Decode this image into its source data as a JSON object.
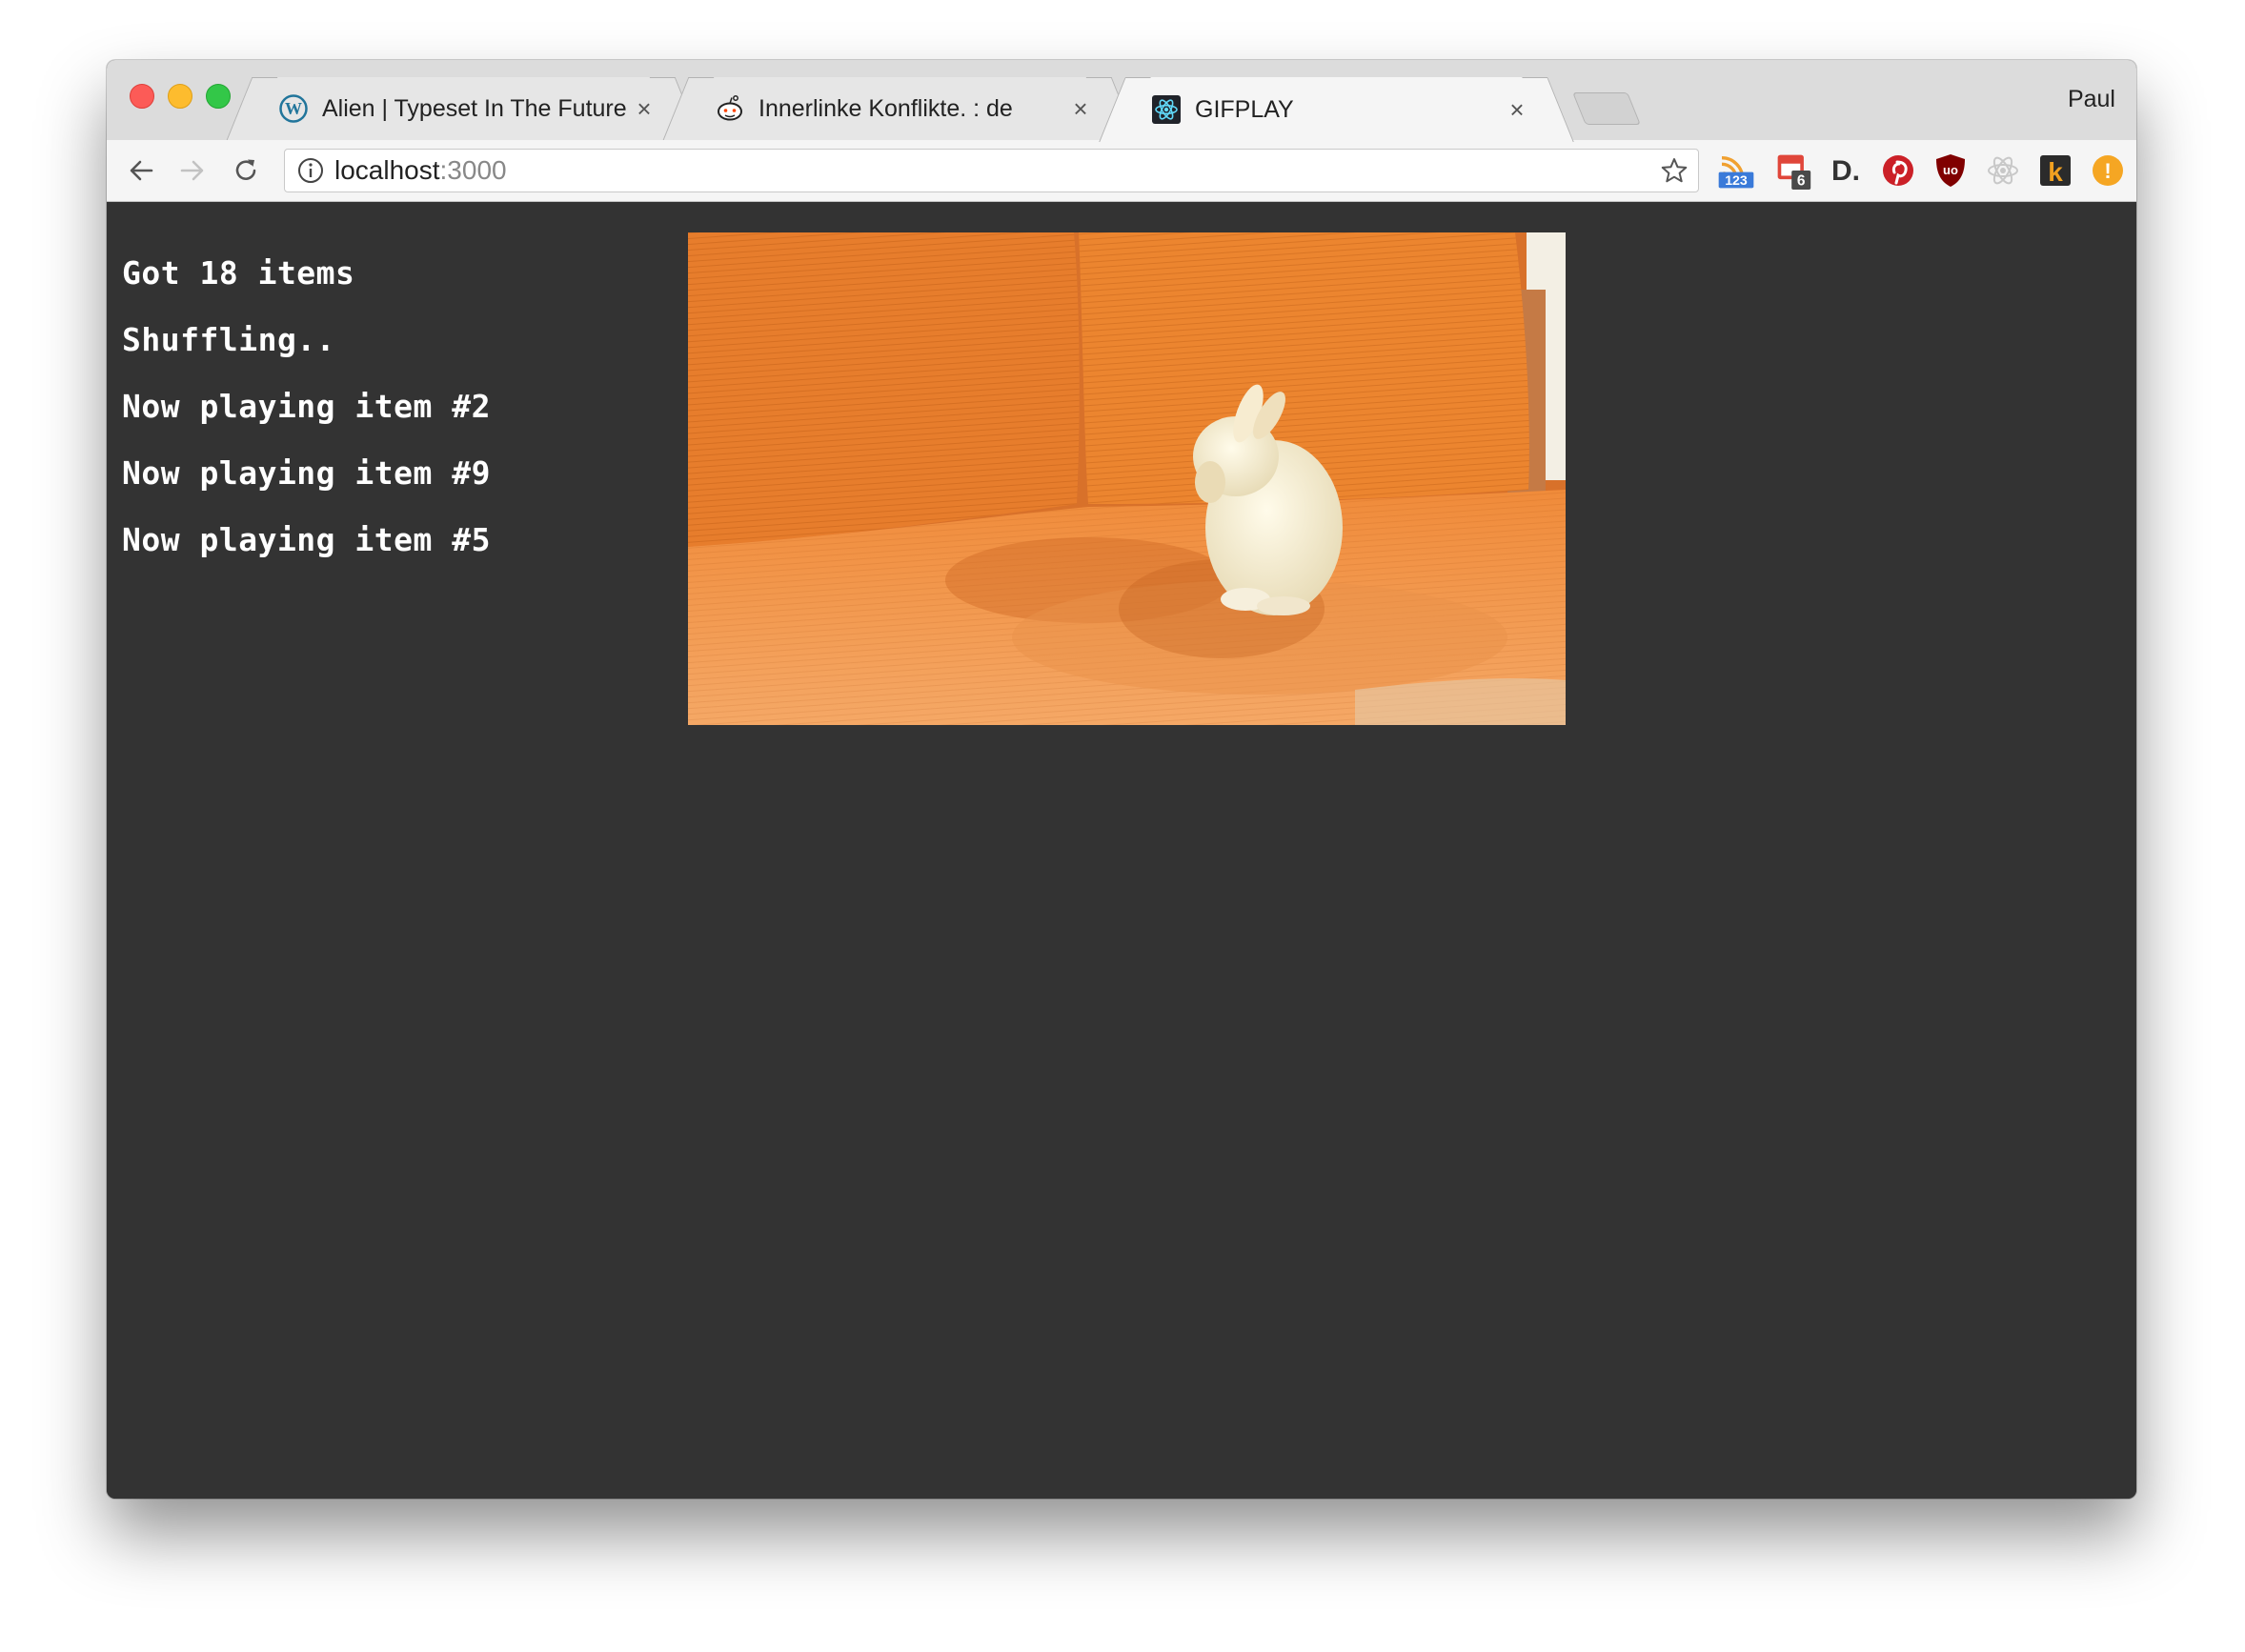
{
  "browser": {
    "tabs": [
      {
        "title": "Alien | Typeset In The Future",
        "favicon": "wordpress-icon",
        "active": false
      },
      {
        "title": "Innerlinke Konflikte. : de",
        "favicon": "reddit-icon",
        "active": false
      },
      {
        "title": "GIFPLAY",
        "favicon": "react-icon",
        "active": true
      }
    ],
    "close_glyph": "×",
    "profile_name": "Paul",
    "address": {
      "host": "localhost",
      "port": ":3000"
    },
    "extensions": [
      {
        "name": "rss-feed-icon",
        "badge": "123"
      },
      {
        "name": "calendar-icon",
        "badge": "6"
      },
      {
        "name": "d-icon",
        "label": "D."
      },
      {
        "name": "pinterest-icon"
      },
      {
        "name": "ublock-icon",
        "label": "uo"
      },
      {
        "name": "react-devtools-icon"
      },
      {
        "name": "k-icon",
        "label": "k"
      },
      {
        "name": "alert-icon",
        "label": "!"
      }
    ]
  },
  "page": {
    "log": [
      "Got 18 items",
      "Shuffling..",
      "Now playing item #2",
      "Now playing item #9",
      "Now playing item #5"
    ],
    "player": {
      "content": "white bunny on orange sofa"
    }
  },
  "colors": {
    "page_background": "#333333",
    "log_text": "#ffffff",
    "sofa": "#e8873a"
  }
}
